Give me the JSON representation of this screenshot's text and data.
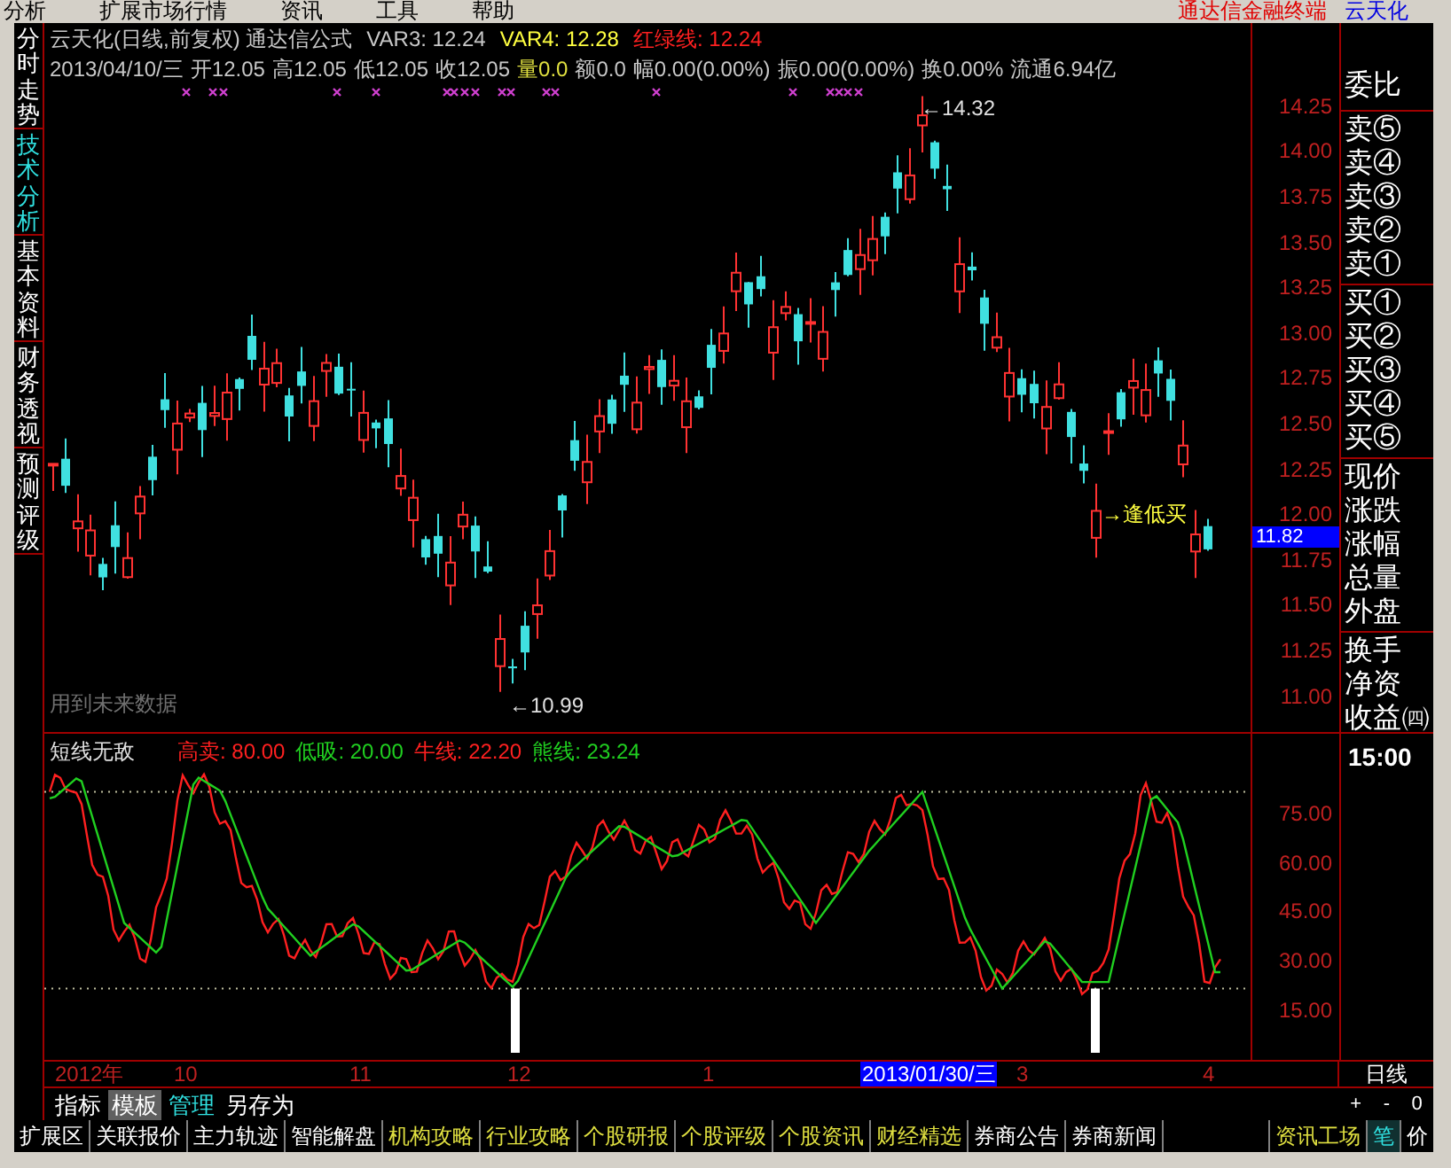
{
  "menu_bar": {
    "items": [
      "分析",
      "扩展市场行情",
      "资讯",
      "工具",
      "帮助"
    ],
    "app_title": "通达信金融终端",
    "stock": "云天化"
  },
  "side_tabs": [
    {
      "label": "分时走势",
      "selected": false
    },
    {
      "label": "技术分析",
      "selected": true
    },
    {
      "label": "基本资料",
      "selected": false
    },
    {
      "label": "财务透视",
      "selected": false
    },
    {
      "label": "预测评级",
      "selected": false
    }
  ],
  "chart_header": {
    "title": "云天化(日线,前复权) 通达信公式",
    "indicators": [
      {
        "label": "VAR3: 12.24",
        "color": "#c8c8c8"
      },
      {
        "label": "VAR4: 12.28",
        "color": "#ffff40"
      },
      {
        "label": "红绿线: 12.24",
        "color": "#ff2020"
      }
    ]
  },
  "quote_line": [
    {
      "label": "2013/04/10/三",
      "color": "#c8c8c8"
    },
    {
      "label": "开12.05",
      "color": "#c8c8c8"
    },
    {
      "label": "高12.05",
      "color": "#c8c8c8"
    },
    {
      "label": "低12.05",
      "color": "#c8c8c8"
    },
    {
      "label": "收12.05",
      "color": "#c8c8c8"
    },
    {
      "label": "量0.0",
      "color": "#e0e040"
    },
    {
      "label": "额0.0",
      "color": "#c8c8c8"
    },
    {
      "label": "幅0.00(0.00%)",
      "color": "#c8c8c8"
    },
    {
      "label": "振0.00(0.00%)",
      "color": "#c8c8c8"
    },
    {
      "label": "换0.00%",
      "color": "#c8c8c8"
    },
    {
      "label": "流通6.94亿",
      "color": "#c8c8c8"
    }
  ],
  "price_chart": {
    "high_label": "←14.32",
    "low_label": "←10.99",
    "signal_label": "→逢低买",
    "note": "用到未来数据",
    "current_price": "11.82",
    "axis_labels": [
      "14.25",
      "14.00",
      "13.75",
      "13.50",
      "13.25",
      "13.00",
      "12.75",
      "12.50",
      "12.25",
      "12.00",
      "11.75",
      "11.50",
      "11.25",
      "11.00"
    ]
  },
  "quote_panel": {
    "groups": [
      [
        "委比"
      ],
      [
        "卖⑤",
        "卖④",
        "卖③",
        "卖②",
        "卖①"
      ],
      [
        "买①",
        "买②",
        "买③",
        "买④",
        "买⑤"
      ],
      [
        "现价",
        "涨跌",
        "涨幅",
        "总量",
        "外盘"
      ],
      [
        "换手",
        "净资",
        "收益㈣"
      ]
    ],
    "time": "15:00"
  },
  "indicator": {
    "name": "短线无敌",
    "values": [
      {
        "label": "高卖: 80.00",
        "color": "#ff2020"
      },
      {
        "label": "低吸: 20.00",
        "color": "#20d020"
      },
      {
        "label": "牛线: 22.20",
        "color": "#ff2020"
      },
      {
        "label": "熊线: 23.24",
        "color": "#20d020"
      }
    ],
    "axis_labels": [
      "75.00",
      "60.00",
      "45.00",
      "30.00",
      "15.00"
    ]
  },
  "time_axis": [
    {
      "label": "2012年",
      "selected": false
    },
    {
      "label": "10",
      "selected": false
    },
    {
      "label": "11",
      "selected": false
    },
    {
      "label": "12",
      "selected": false
    },
    {
      "label": "1",
      "selected": false
    },
    {
      "label": "2013/01/30/三",
      "selected": true
    },
    {
      "label": "3",
      "selected": false
    },
    {
      "label": "4",
      "selected": false
    }
  ],
  "period": "日线",
  "zoom_buttons": [
    "+",
    "-",
    "0"
  ],
  "template_toolbar": [
    {
      "label": "指标",
      "selected": false,
      "color": "#ffffff"
    },
    {
      "label": "模板",
      "selected": true,
      "color": "#ffffff"
    },
    {
      "label": "管理",
      "selected": false,
      "color": "#30e0e0"
    },
    {
      "label": "另存为",
      "selected": false,
      "color": "#ffffff"
    }
  ],
  "bottom_tabs": [
    {
      "label": "扩展区",
      "color": "#ffffff"
    },
    {
      "label": "关联报价",
      "color": "#ffffff"
    },
    {
      "label": "主力轨迹",
      "color": "#ffffff"
    },
    {
      "label": "智能解盘",
      "color": "#ffffff"
    },
    {
      "label": "机构攻略",
      "color": "#e0e040"
    },
    {
      "label": "行业攻略",
      "color": "#e0e040"
    },
    {
      "label": "个股研报",
      "color": "#e0e040"
    },
    {
      "label": "个股评级",
      "color": "#e0e040"
    },
    {
      "label": "个股资讯",
      "color": "#e0e040"
    },
    {
      "label": "财经精选",
      "color": "#e0e040"
    },
    {
      "label": "券商公告",
      "color": "#ffffff"
    },
    {
      "label": "券商新闻",
      "color": "#ffffff"
    }
  ],
  "right_tabs": [
    {
      "label": "资讯工场",
      "color": "#e0e040",
      "selected": false
    },
    {
      "label": "笔",
      "color": "#30e0e0",
      "selected": true
    },
    {
      "label": "价",
      "color": "#ffffff",
      "selected": false
    }
  ]
}
